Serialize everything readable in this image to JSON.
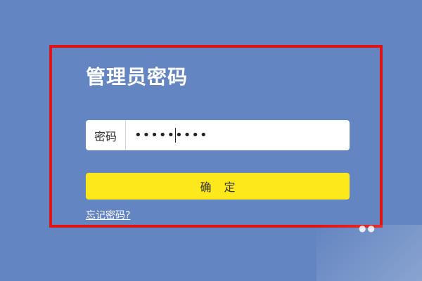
{
  "login_panel": {
    "title": "管理员密码",
    "password_label": "密码",
    "password_value": "•••••••••",
    "confirm_label": "确定",
    "forgot_label": "忘记密码?"
  },
  "colors": {
    "background": "#6385c1",
    "highlight_border": "#e01414",
    "confirm_button": "#fde81c",
    "text_light": "#ffffff"
  },
  "icons": {
    "watermark": "watermark-icon"
  }
}
